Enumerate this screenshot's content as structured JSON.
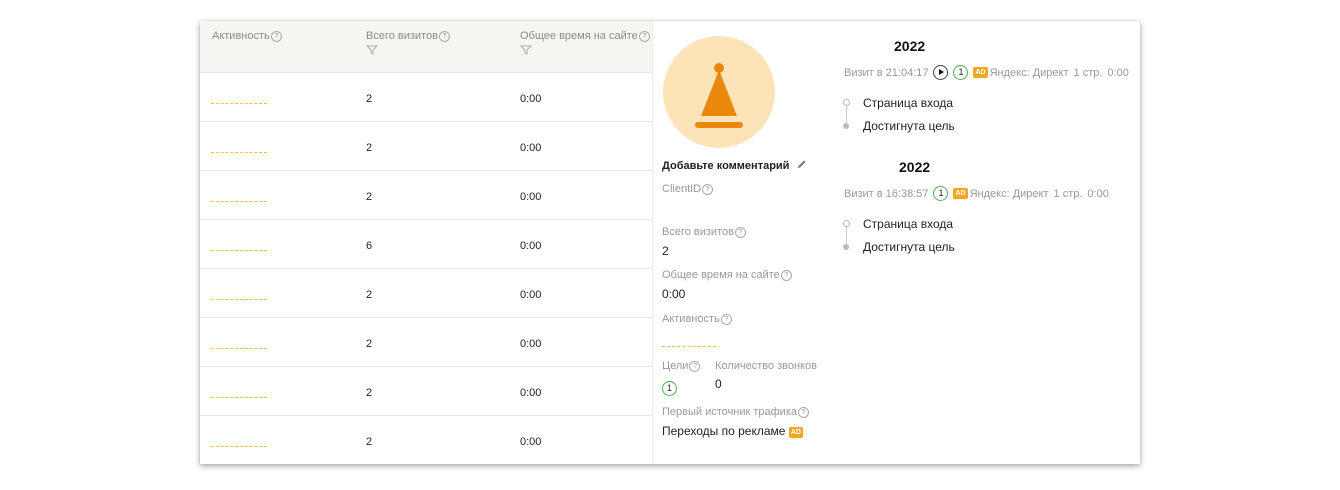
{
  "table": {
    "headers": {
      "activity": "Активность",
      "visits": "Всего визитов",
      "time": "Общее время на сайте"
    },
    "rows": [
      {
        "visits": "2",
        "time": "0:00"
      },
      {
        "visits": "2",
        "time": "0:00"
      },
      {
        "visits": "2",
        "time": "0:00"
      },
      {
        "visits": "6",
        "time": "0:00"
      },
      {
        "visits": "2",
        "time": "0:00"
      },
      {
        "visits": "2",
        "time": "0:00"
      },
      {
        "visits": "2",
        "time": "0:00"
      },
      {
        "visits": "2",
        "time": "0:00"
      }
    ]
  },
  "profile": {
    "comment_label": "Добавьте комментарий",
    "client_id_label": "ClientID",
    "visits_label": "Всего визитов",
    "visits_value": "2",
    "time_label": "Общее время на сайте",
    "time_value": "0:00",
    "activity_label": "Активность",
    "goals_label": "Цели",
    "goals_value": "1",
    "calls_label": "Количество звонков",
    "calls_value": "0",
    "source_label": "Первый источник трафика",
    "source_value": "Переходы по рекламе",
    "ad_badge": "AD"
  },
  "visits": [
    {
      "year": "2022",
      "time_label": "Визит в 21:04:17",
      "goals": "1",
      "source": "Яндекс: Директ",
      "pages": "1 стр.",
      "duration": "0:00",
      "steps": [
        "Страница входа",
        "Достигнута цель"
      ]
    },
    {
      "year": "2022",
      "time_label": "Визит в 16:38:57",
      "goals": "1",
      "source": "Яндекс: Директ",
      "pages": "1 стр.",
      "duration": "0:00",
      "steps": [
        "Страница входа",
        "Достигнута цель"
      ]
    }
  ],
  "colors": {
    "accent": "#e8890c",
    "avatar_bg": "#fde3b8",
    "ad_badge": "#f6a623",
    "goal_ring": "#4caf50",
    "activity_dash": "#f1c232"
  },
  "icons": {
    "help": "help-circle-icon",
    "filter": "funnel-filter-icon",
    "edit": "pencil-icon",
    "play": "play-icon",
    "avatar": "party-hat-icon"
  }
}
